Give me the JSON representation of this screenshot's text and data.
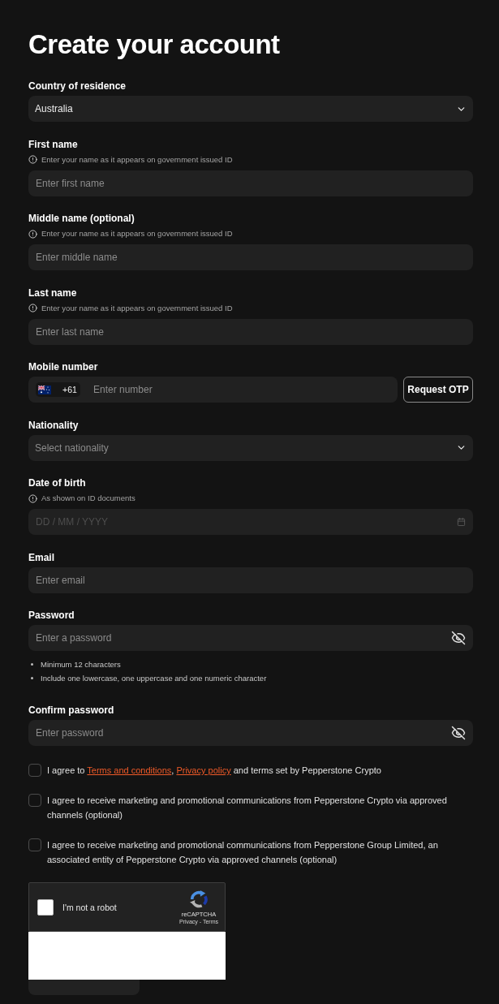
{
  "title": "Create your account",
  "fields": [
    {
      "kind": "select",
      "label": "Country of residence",
      "value": "Australia"
    },
    {
      "kind": "text",
      "label": "First name",
      "hint": "Enter your name as it appears on government issued ID",
      "placeholder": "Enter first name"
    },
    {
      "kind": "text",
      "label": "Middle name (optional)",
      "hint": "Enter your name as it appears on government issued ID",
      "placeholder": "Enter middle name"
    },
    {
      "kind": "text",
      "label": "Last name",
      "hint": "Enter your name as it appears on government issued ID",
      "placeholder": "Enter last name"
    },
    {
      "kind": "phone",
      "label": "Mobile number",
      "dial_code": "+61",
      "placeholder": "Enter number",
      "button": "Request OTP"
    },
    {
      "kind": "select",
      "label": "Nationality",
      "placeholder": "Select nationality"
    },
    {
      "kind": "date",
      "label": "Date of birth",
      "hint": "As shown on ID documents",
      "placeholder": "DD / MM / YYYY"
    },
    {
      "kind": "text",
      "label": "Email",
      "placeholder": "Enter email"
    },
    {
      "kind": "password",
      "label": "Password",
      "placeholder": "Enter a password",
      "revealed": false,
      "requirements": [
        "Minimum 12 characters",
        "Include one lowercase, one uppercase and one numeric character"
      ]
    },
    {
      "kind": "password",
      "label": "Confirm password",
      "placeholder": "Enter password",
      "revealed": false
    }
  ],
  "consents": [
    {
      "checked": false,
      "segments": [
        {
          "kind": "text",
          "text": "I agree to "
        },
        {
          "kind": "link",
          "text": "Terms and conditions"
        },
        {
          "kind": "text",
          "text": ", "
        },
        {
          "kind": "link",
          "text": "Privacy policy"
        },
        {
          "kind": "text",
          "text": " and terms set by Pepperstone Crypto"
        }
      ]
    },
    {
      "checked": false,
      "segments": [
        {
          "kind": "text",
          "text": "I agree to receive marketing and promotional communications from Pepperstone Crypto via approved channels (optional)"
        }
      ]
    },
    {
      "checked": false,
      "segments": [
        {
          "kind": "text",
          "text": "I agree to receive marketing and promotional communications from Pepperstone Group Limited, an associated entity of Pepperstone Crypto via approved channels (optional)"
        }
      ]
    }
  ],
  "captcha": {
    "checked": false,
    "label": "I'm not a robot",
    "brand": "reCAPTCHA",
    "links": "Privacy - Terms"
  }
}
